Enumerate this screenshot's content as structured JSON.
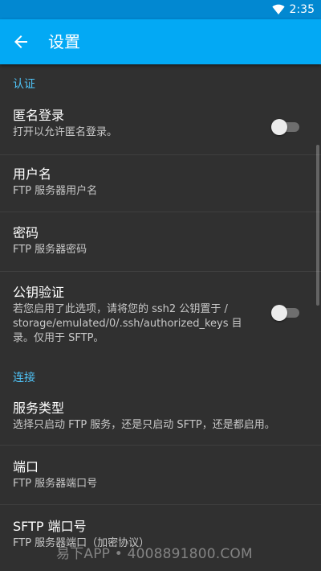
{
  "status_bar": {
    "time": "2:35",
    "wifi_icon": "wifi-icon",
    "background": "#0288d1"
  },
  "app_bar": {
    "title": "设置",
    "back_icon": "arrow-back-icon",
    "background": "#03a9f4"
  },
  "sections": {
    "auth": {
      "header": "认证",
      "anonymous": {
        "title": "匿名登录",
        "summary": "打开以允许匿名登录。",
        "enabled": false
      },
      "username": {
        "title": "用户名",
        "summary": "FTP 服务器用户名"
      },
      "password": {
        "title": "密码",
        "summary": "FTP 服务器密码"
      },
      "pubkey": {
        "title": "公钥验证",
        "summary_line1": "若您启用了此选项，请将您的 ssh2 公钥置于 /",
        "summary_line2": "storage/emulated/0/.ssh/authorized_keys 目",
        "summary_line3": "录。仅用于 SFTP。",
        "enabled": false
      }
    },
    "connection": {
      "header": "连接",
      "service_type": {
        "title": "服务类型",
        "summary": "选择只启动 FTP 服务，还是只启动 SFTP，还是都启用。"
      },
      "port": {
        "title": "端口",
        "summary": "FTP 服务器端口号"
      },
      "sftp_port": {
        "title": "SFTP 端口号",
        "summary": "FTP 服务器端口（加密协议）"
      }
    }
  },
  "watermark": "易下APP • 4008891800.COM",
  "colors": {
    "accent": "#4fc3f7",
    "background": "#303030"
  }
}
